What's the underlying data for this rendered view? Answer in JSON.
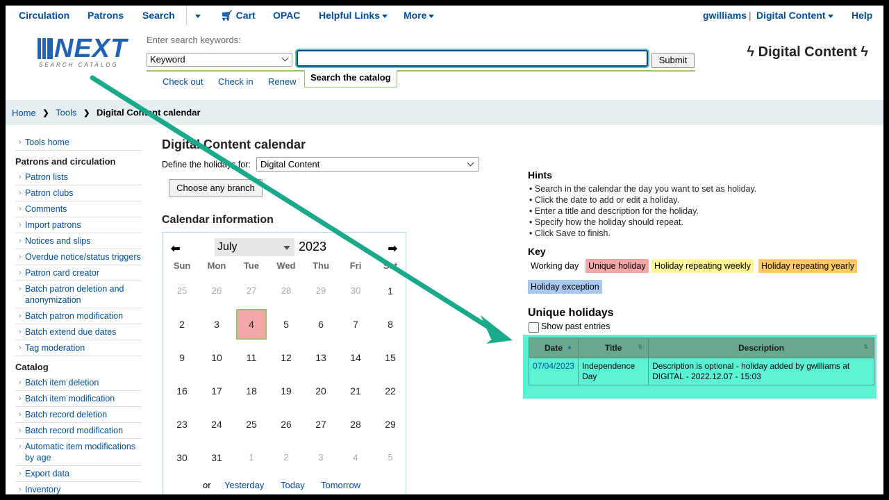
{
  "topnav": {
    "circulation": "Circulation",
    "patrons": "Patrons",
    "search": "Search",
    "cart": "Cart",
    "opac": "OPAC",
    "helpful_links": "Helpful Links",
    "more": "More",
    "user": "gwilliams",
    "separator": "|",
    "library": "Digital Content",
    "help": "Help"
  },
  "logo": {
    "word": "NEXT",
    "tagline": "SEARCH CATALOG"
  },
  "search": {
    "hint": "Enter search keywords:",
    "type_selected": "Keyword",
    "query": "",
    "submit": "Submit",
    "tabs": {
      "checkout": "Check out",
      "checkin": "Check in",
      "renew": "Renew",
      "catalog": "Search the catalog"
    }
  },
  "header_library": "Digital Content",
  "breadcrumb": {
    "home": "Home",
    "tools": "Tools",
    "current": "Digital Content calendar"
  },
  "sidebar": {
    "tools_home": "Tools home",
    "sections": [
      {
        "title": "Patrons and circulation",
        "items": [
          "Patron lists",
          "Patron clubs",
          "Comments",
          "Import patrons",
          "Notices and slips",
          "Overdue notice/status triggers",
          "Patron card creator",
          "Batch patron deletion and anonymization",
          "Batch patron modification",
          "Batch extend due dates",
          "Tag moderation"
        ]
      },
      {
        "title": "Catalog",
        "items": [
          "Batch item deletion",
          "Batch item modification",
          "Batch record deletion",
          "Batch record modification",
          "Automatic item modifications by age",
          "Export data",
          "Inventory"
        ]
      }
    ]
  },
  "main": {
    "title": "Digital Content calendar",
    "define_label": "Define the holidays for:",
    "branch_selected": "Digital Content",
    "any_branch_button": "Choose any branch",
    "calendar_info_title": "Calendar information"
  },
  "calendar": {
    "month": "July",
    "year": "2023",
    "weekdays": [
      "Sun",
      "Mon",
      "Tue",
      "Wed",
      "Thu",
      "Fri",
      "Sat"
    ],
    "weeks": [
      [
        "25",
        "26",
        "27",
        "28",
        "29",
        "30",
        "1"
      ],
      [
        "2",
        "3",
        "4",
        "5",
        "6",
        "7",
        "8"
      ],
      [
        "9",
        "10",
        "11",
        "12",
        "13",
        "14",
        "15"
      ],
      [
        "16",
        "17",
        "18",
        "19",
        "20",
        "21",
        "22"
      ],
      [
        "23",
        "24",
        "25",
        "26",
        "27",
        "28",
        "29"
      ],
      [
        "30",
        "31",
        "1",
        "2",
        "3",
        "4",
        "5"
      ]
    ],
    "holiday_day": "4",
    "footer": {
      "or": "or",
      "yesterday": "Yesterday",
      "today": "Today",
      "tomorrow": "Tomorrow"
    }
  },
  "hints": {
    "title": "Hints",
    "items": [
      "Search in the calendar the day you want to set as holiday.",
      "Click the date to add or edit a holiday.",
      "Enter a title and description for the holiday.",
      "Specify how the holiday should repeat.",
      "Click Save to finish."
    ]
  },
  "key": {
    "title": "Key",
    "working": "Working day",
    "unique": "Unique holiday",
    "weekly": "Holiday repeating weekly",
    "yearly": "Holiday repeating yearly",
    "exception": "Holiday exception"
  },
  "unique_holidays": {
    "title": "Unique holidays",
    "show_past": "Show past entries",
    "columns": [
      "Date",
      "Title",
      "Description"
    ],
    "rows": [
      {
        "date": "07/04/2023",
        "title": "Independence Day",
        "description": "Description is optional - holiday added by gwilliams at DIGITAL - 2022.12.07 - 15:03"
      }
    ]
  },
  "colors": {
    "link": "#004d99",
    "unique_holiday": "#f3a7a7",
    "weekly": "#fff799",
    "yearly": "#ffc966",
    "exception": "#a9c8f0",
    "highlight": "#5cf2d6",
    "arrow": "#1aa98a"
  }
}
